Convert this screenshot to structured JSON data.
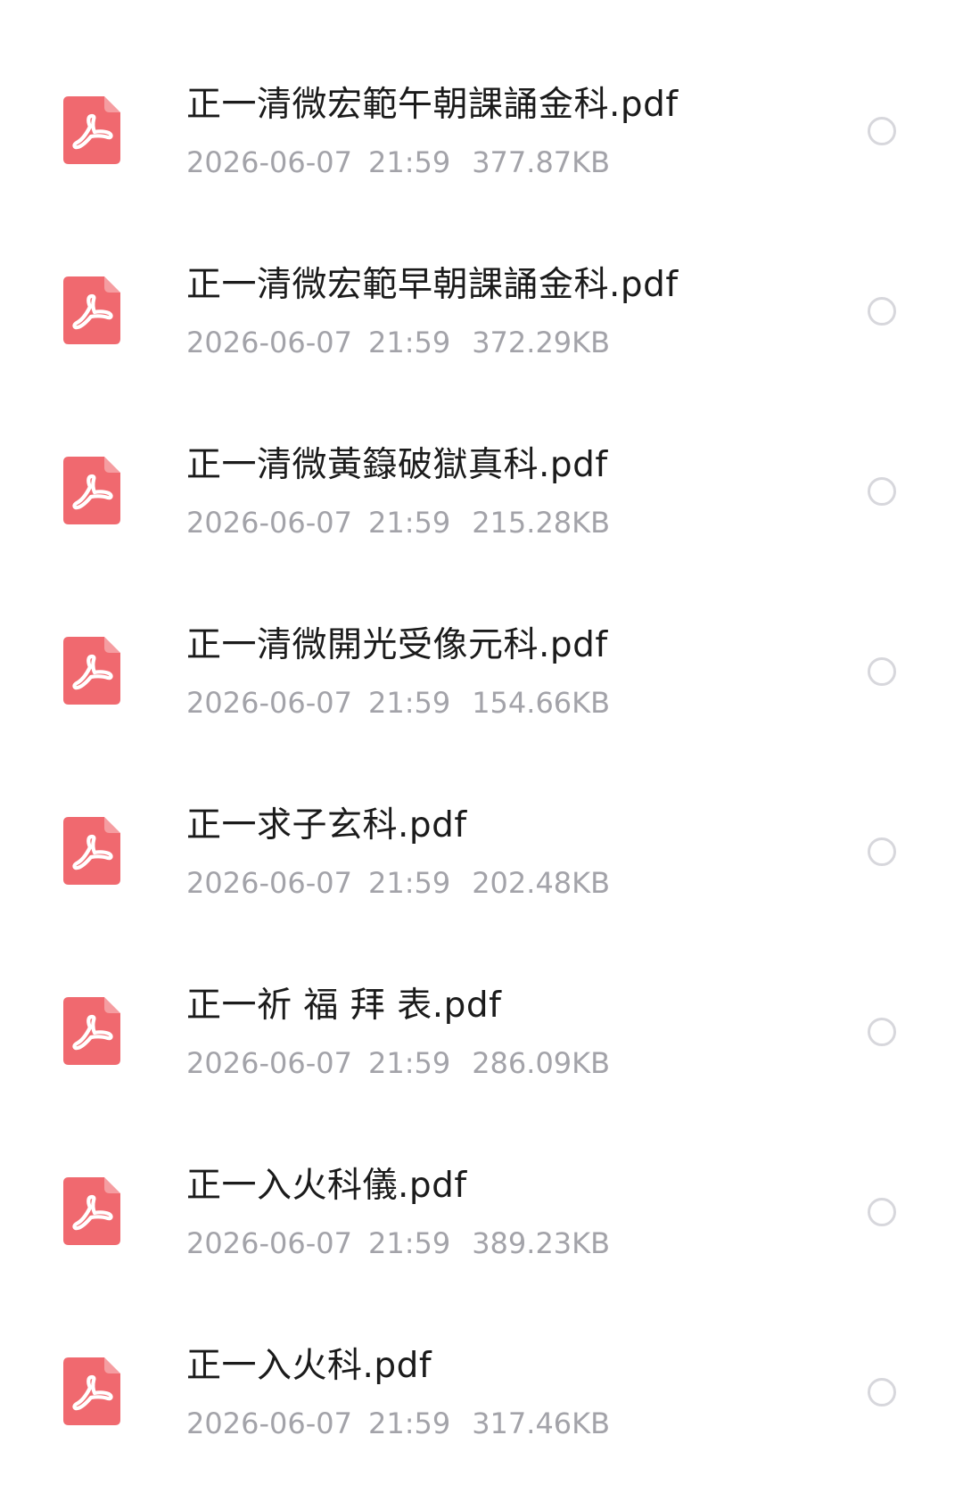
{
  "icon_color": "#f0696f",
  "files": [
    {
      "name": "正一清微宏範午朝課誦金科.pdf",
      "date": "2026-06-07",
      "time": "21:59",
      "size": "377.87KB",
      "icon": "pdf-icon"
    },
    {
      "name": "正一清微宏範早朝課誦金科.pdf",
      "date": "2026-06-07",
      "time": "21:59",
      "size": "372.29KB",
      "icon": "pdf-icon"
    },
    {
      "name": "正一清微黃籙破獄真科.pdf",
      "date": "2026-06-07",
      "time": "21:59",
      "size": "215.28KB",
      "icon": "pdf-icon"
    },
    {
      "name": "正一清微開光受像元科.pdf",
      "date": "2026-06-07",
      "time": "21:59",
      "size": "154.66KB",
      "icon": "pdf-icon"
    },
    {
      "name": "正一求子玄科.pdf",
      "date": "2026-06-07",
      "time": "21:59",
      "size": "202.48KB",
      "icon": "pdf-icon"
    },
    {
      "name": "正一祈 福 拜 表.pdf",
      "date": "2026-06-07",
      "time": "21:59",
      "size": "286.09KB",
      "icon": "pdf-icon"
    },
    {
      "name": "正一入火科儀.pdf",
      "date": "2026-06-07",
      "time": "21:59",
      "size": "389.23KB",
      "icon": "pdf-icon"
    },
    {
      "name": "正一入火科.pdf",
      "date": "2026-06-07",
      "time": "21:59",
      "size": "317.46KB",
      "icon": "pdf-icon"
    }
  ]
}
